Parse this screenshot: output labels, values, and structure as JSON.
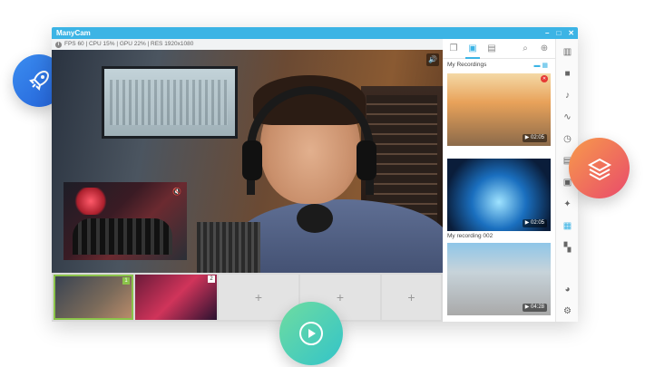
{
  "window": {
    "title": "ManyCam",
    "controls": [
      "–",
      "□",
      "✕"
    ]
  },
  "status": {
    "info_icon": "i",
    "text": "FPS 60 | CPU 15% | GPU 22% | RES 1920x1080"
  },
  "panel": {
    "heading": "My Recordings",
    "recordings": [
      {
        "duration": "02:05",
        "label": ""
      },
      {
        "duration": "02:05",
        "label": "My recording 002"
      },
      {
        "duration": "04:28",
        "label": ""
      }
    ]
  },
  "scenes": [
    {
      "number": "1"
    },
    {
      "number": "2"
    }
  ],
  "scene_add": [
    "+",
    "+",
    "+"
  ],
  "icons": {
    "main_volume": "volume-icon",
    "pip_mute": "mute-icon",
    "broadcast": "broadcast-icon",
    "floating": [
      "rocket-icon",
      "layers-icon",
      "play-icon"
    ]
  }
}
